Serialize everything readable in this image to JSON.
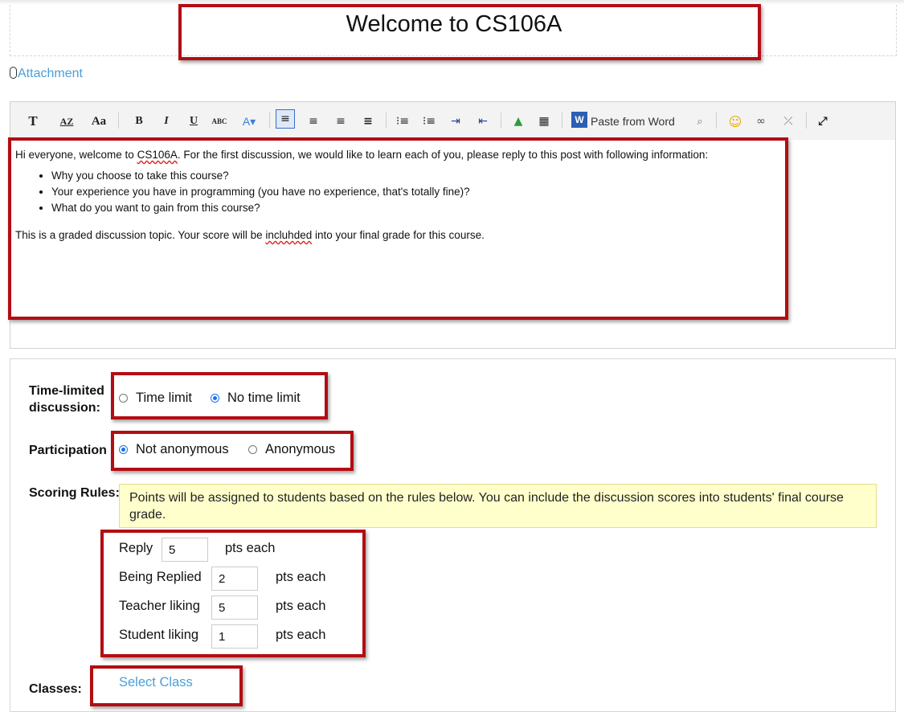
{
  "title": "Welcome to CS106A",
  "attachment_label": "Attachment",
  "toolbar": {
    "items": [
      {
        "name": "font-style-icon",
        "glyph": "T"
      },
      {
        "name": "font-case-icon",
        "glyph": "AZ"
      },
      {
        "name": "font-size-icon",
        "glyph": "Aa"
      },
      {
        "name": "bold-icon",
        "glyph": "B"
      },
      {
        "name": "italic-icon",
        "glyph": "I"
      },
      {
        "name": "underline-icon",
        "glyph": "U"
      },
      {
        "name": "strikethrough-icon",
        "glyph": "ABC"
      },
      {
        "name": "font-color-icon",
        "glyph": "A▾"
      },
      {
        "name": "align-left-icon",
        "glyph": "≡"
      },
      {
        "name": "align-center-icon",
        "glyph": "≡"
      },
      {
        "name": "align-right-icon",
        "glyph": "≡"
      },
      {
        "name": "align-justify-icon",
        "glyph": "≡"
      },
      {
        "name": "ordered-list-icon",
        "glyph": "⁝≡"
      },
      {
        "name": "bullet-list-icon",
        "glyph": "⁝≡"
      },
      {
        "name": "indent-icon",
        "glyph": "⇥"
      },
      {
        "name": "outdent-icon",
        "glyph": "⇤"
      },
      {
        "name": "image-icon",
        "glyph": "▲"
      },
      {
        "name": "table-icon",
        "glyph": "▦"
      },
      {
        "name": "paste-word-icon",
        "glyph": "W"
      },
      {
        "name": "preview-icon",
        "glyph": "🔍"
      },
      {
        "name": "emoji-icon",
        "glyph": "☺"
      },
      {
        "name": "link-icon",
        "glyph": "∞"
      },
      {
        "name": "unlink-icon",
        "glyph": "⤫"
      },
      {
        "name": "fullscreen-icon",
        "glyph": "⤢"
      }
    ],
    "paste_from_word_label": "Paste from Word"
  },
  "editor": {
    "intro_pre": "Hi everyone, welcome to ",
    "intro_course": "CS106A",
    "intro_post": ". For the first discussion, we would like to learn each of you, please reply to this post with following information:",
    "bullets": [
      "Why you choose to take this course?",
      "Your experience you have in programming (you have no experience, that's totally fine)?",
      "What do you want to gain from this course?"
    ],
    "footer_pre": "This is a graded discussion topic. Your score will be ",
    "footer_typo": "incluhded",
    "footer_post": " into your final grade for this course."
  },
  "settings": {
    "time_limited_label": "Time-limited discussion:",
    "time_limit_option": "Time limit",
    "no_time_limit_option": "No time limit",
    "time_selected": "No time limit",
    "participation_label": "Participation",
    "not_anonymous_option": "Not anonymous",
    "anonymous_option": "Anonymous",
    "participation_selected": "Not anonymous",
    "scoring_label": "Scoring Rules:",
    "scoring_notice": "Points will be assigned to students based on the rules below. You can include the discussion scores into students' final course grade.",
    "rules": [
      {
        "label": "Reply",
        "value": "5",
        "unit": "pts each"
      },
      {
        "label": "Being Replied",
        "value": "2",
        "unit": "pts each"
      },
      {
        "label": "Teacher liking",
        "value": "5",
        "unit": "pts each"
      },
      {
        "label": "Student liking",
        "value": "1",
        "unit": "pts each"
      }
    ],
    "classes_label": "Classes:",
    "select_class_link": "Select Class"
  },
  "colors": {
    "highlight_border": "#b30d12",
    "link": "#4a9fd8",
    "notice_bg": "#ffffcc",
    "radio_selected": "#1a73e8"
  }
}
